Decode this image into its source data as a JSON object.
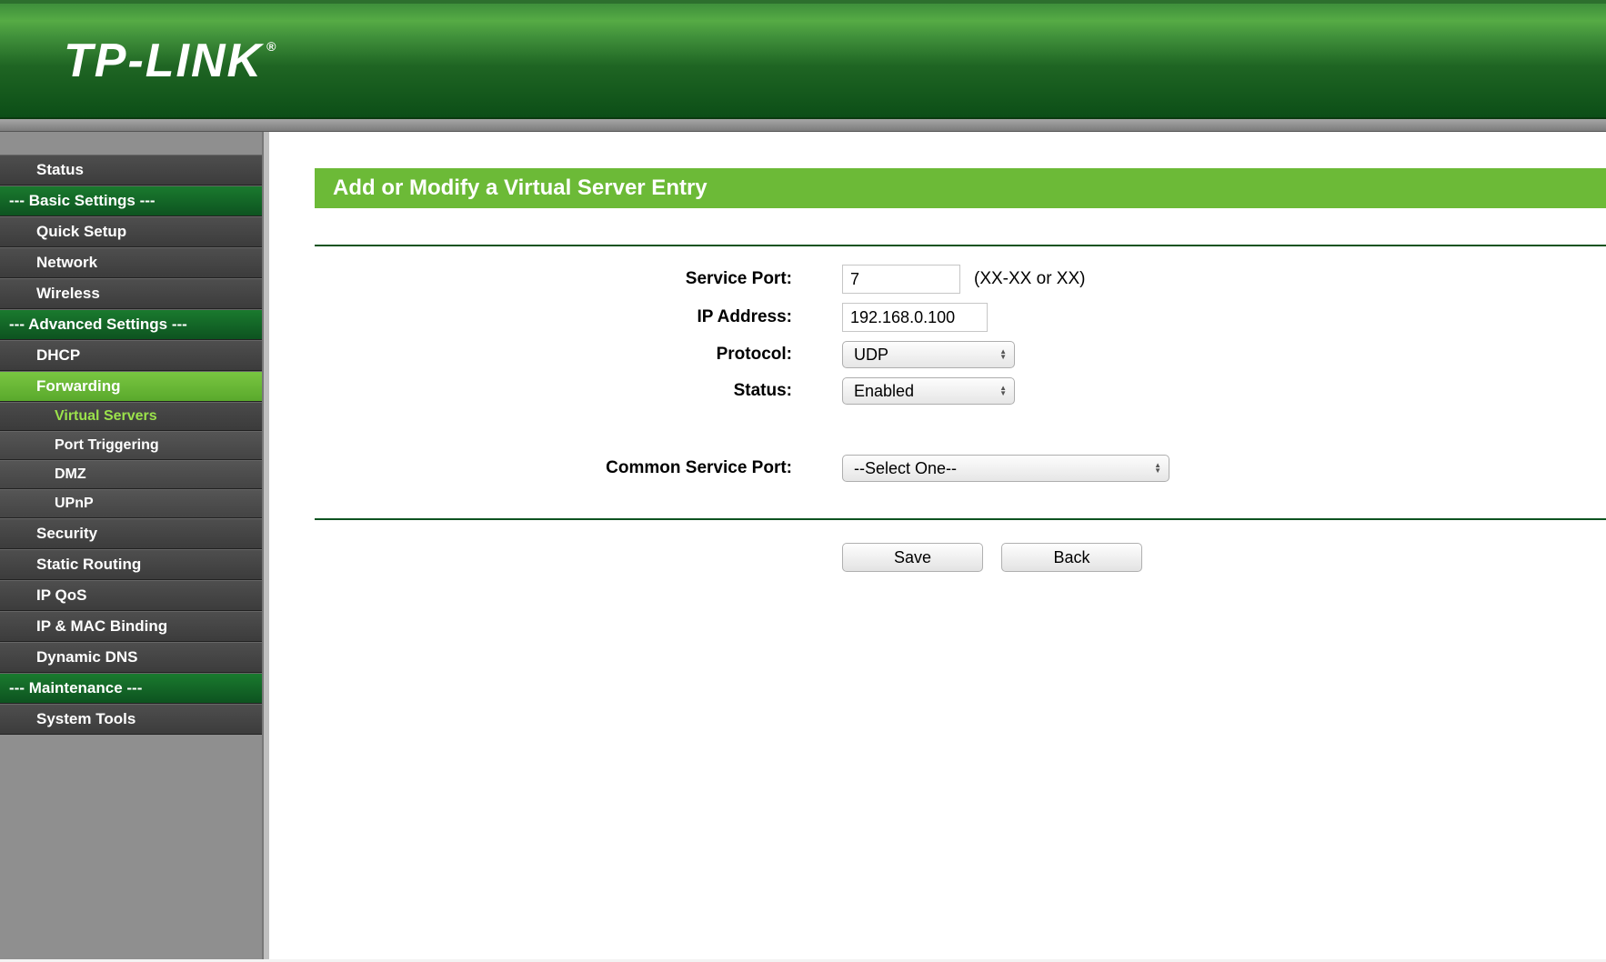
{
  "brand": "TP-LINK",
  "sidebar": {
    "items": [
      {
        "kind": "item",
        "label": "Status"
      },
      {
        "kind": "section",
        "label": "--- Basic Settings ---"
      },
      {
        "kind": "item",
        "label": "Quick Setup"
      },
      {
        "kind": "item",
        "label": "Network"
      },
      {
        "kind": "item",
        "label": "Wireless"
      },
      {
        "kind": "section",
        "label": "--- Advanced Settings ---"
      },
      {
        "kind": "item",
        "label": "DHCP"
      },
      {
        "kind": "item",
        "label": "Forwarding",
        "active": true
      },
      {
        "kind": "sub",
        "label": "Virtual Servers",
        "active": true
      },
      {
        "kind": "sub",
        "label": "Port Triggering"
      },
      {
        "kind": "sub",
        "label": "DMZ"
      },
      {
        "kind": "sub",
        "label": "UPnP"
      },
      {
        "kind": "item",
        "label": "Security"
      },
      {
        "kind": "item",
        "label": "Static Routing"
      },
      {
        "kind": "item",
        "label": "IP QoS"
      },
      {
        "kind": "item",
        "label": "IP & MAC Binding"
      },
      {
        "kind": "item",
        "label": "Dynamic DNS"
      },
      {
        "kind": "section",
        "label": "--- Maintenance ---"
      },
      {
        "kind": "item",
        "label": "System Tools"
      }
    ]
  },
  "page": {
    "title": "Add or Modify a Virtual Server Entry",
    "fields": {
      "service_port": {
        "label": "Service Port:",
        "value": "7",
        "hint": "(XX-XX or XX)"
      },
      "ip_address": {
        "label": "IP Address:",
        "value": "192.168.0.100"
      },
      "protocol": {
        "label": "Protocol:",
        "value": "UDP"
      },
      "status": {
        "label": "Status:",
        "value": "Enabled"
      },
      "common_service_port": {
        "label": "Common Service Port:",
        "value": "--Select One--"
      }
    },
    "buttons": {
      "save": "Save",
      "back": "Back"
    }
  }
}
